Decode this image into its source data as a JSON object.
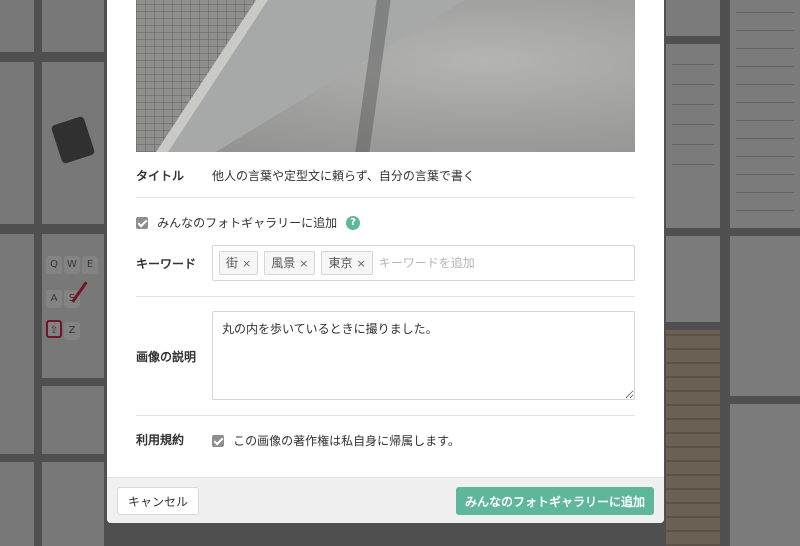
{
  "modal": {
    "title_label": "タイトル",
    "title_value": "他人の言葉や定型文に頼らず、自分の言葉で書く",
    "gallery_checkbox_label": "みんなのフォトギャラリーに追加",
    "gallery_checked": true,
    "help_icon": "?",
    "keywords_label": "キーワード",
    "tags": [
      "街",
      "風景",
      "東京"
    ],
    "tag_remove": "×",
    "keyword_placeholder": "キーワードを追加",
    "description_label": "画像の説明",
    "description_value": "丸の内を歩いているときに撮りました。",
    "terms_label": "利用規約",
    "terms_checkbox_label": "この画像の著作権は私自身に帰属します。",
    "terms_checked": true,
    "cancel_label": "キャンセル",
    "submit_label": "みんなのフォトギャラリーに追加",
    "accent_color": "#5fb79b"
  },
  "background": {
    "keyboard_keys_row1": [
      "Q",
      "W",
      "E"
    ],
    "keyboard_keys_row2": [
      "A",
      "S"
    ],
    "keyboard_keys_row3": [
      "Z"
    ]
  }
}
